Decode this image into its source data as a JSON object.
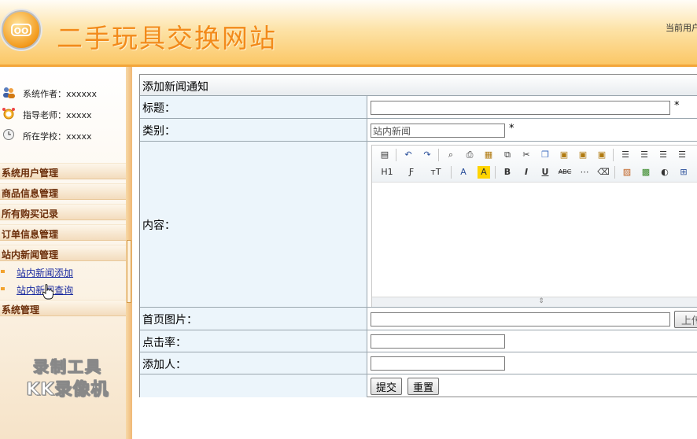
{
  "header": {
    "logo_text": "OO",
    "site_title": "二手玩具交换网站",
    "current_user_label": "当前用户"
  },
  "sidebar": {
    "info": [
      {
        "icon": "users-icon",
        "label": "系统作者：xxxxxx"
      },
      {
        "icon": "alarm-clock-icon",
        "label": "指导老师：xxxxx"
      },
      {
        "icon": "clock-icon",
        "label": "所在学校：xxxxx"
      }
    ],
    "menus": [
      {
        "label": "系统用户管理"
      },
      {
        "label": "商品信息管理"
      },
      {
        "label": "所有购买记录"
      },
      {
        "label": "订单信息管理"
      },
      {
        "label": "站内新闻管理"
      },
      {
        "label": "系统管理"
      }
    ],
    "sub_items": [
      {
        "label": "站内新闻添加"
      },
      {
        "label": "站内新闻查询"
      }
    ]
  },
  "watermark": {
    "line1": "录制工具",
    "line2": "KK录像机"
  },
  "form": {
    "title": "添加新闻通知",
    "fields": {
      "title_label": "标题：",
      "category_label": "类别：",
      "category_value": "站内新闻",
      "content_label": "内容：",
      "image_label": "首页图片：",
      "upload_button": "上传",
      "clicks_label": "点击率：",
      "adder_label": "添加人：",
      "required_mark": "*"
    },
    "buttons": {
      "submit": "提交",
      "reset": "重置"
    }
  },
  "editor": {
    "toolbar_row1": [
      "source-icon",
      "undo-icon",
      "redo-icon",
      "preview-icon",
      "print-icon",
      "template-icon",
      "paste-word-icon",
      "cut-icon",
      "copy-icon",
      "paste-icon",
      "paste-text-icon",
      "paste-format-icon",
      "align-left-icon",
      "align-center-icon",
      "align-right-icon",
      "justify-icon"
    ],
    "toolbar_row2_labels": {
      "heading": "H1",
      "font": "Ƒ",
      "size": "тT",
      "color": "A",
      "highlight": "A",
      "bold": "B",
      "italic": "I",
      "underline": "U",
      "strike": "ABC"
    },
    "toolbar_row2_icons": [
      "hr-icon",
      "eraser-icon",
      "image-icon",
      "flash-icon",
      "media-icon",
      "table-icon"
    ]
  }
}
